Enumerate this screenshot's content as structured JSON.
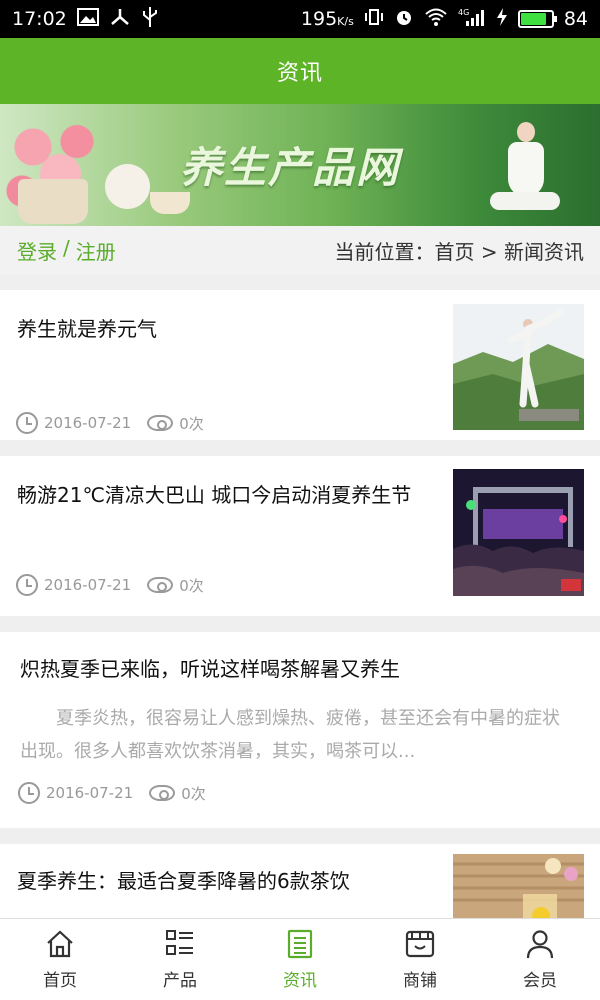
{
  "status": {
    "time": "17:02",
    "speed": "195",
    "speed_unit": "K/s",
    "battery": "84",
    "network": "4G"
  },
  "header": {
    "title": "资讯"
  },
  "banner": {
    "title": "养生产品网"
  },
  "crumbbar": {
    "login": "登录",
    "separator": "/",
    "register": "注册",
    "location": "当前位置：首页 > 新闻资讯"
  },
  "articles": [
    {
      "title": "养生就是养元气",
      "date": "2016-07-21",
      "views": "0次"
    },
    {
      "title": "畅游21℃清凉大巴山 城口今启动消夏养生节",
      "date": "2016-07-21",
      "views": "0次"
    },
    {
      "title": "炽热夏季已来临，听说这样喝茶解暑又养生",
      "summary": "夏季炎热，很容易让人感到燥热、疲倦，甚至还会有中暑的症状出现。很多人都喜欢饮茶消暑，其实，喝茶可以...",
      "date": "2016-07-21",
      "views": "0次"
    },
    {
      "title": "夏季养生：最适合夏季降暑的6款茶饮"
    }
  ],
  "tabs": [
    {
      "label": "首页",
      "icon": "home-icon"
    },
    {
      "label": "产品",
      "icon": "grid-list-icon"
    },
    {
      "label": "资讯",
      "icon": "document-icon",
      "active": true
    },
    {
      "label": "商铺",
      "icon": "store-icon"
    },
    {
      "label": "会员",
      "icon": "user-icon"
    }
  ],
  "colors": {
    "brand": "#5db427",
    "accent_text": "#5aad2a"
  }
}
